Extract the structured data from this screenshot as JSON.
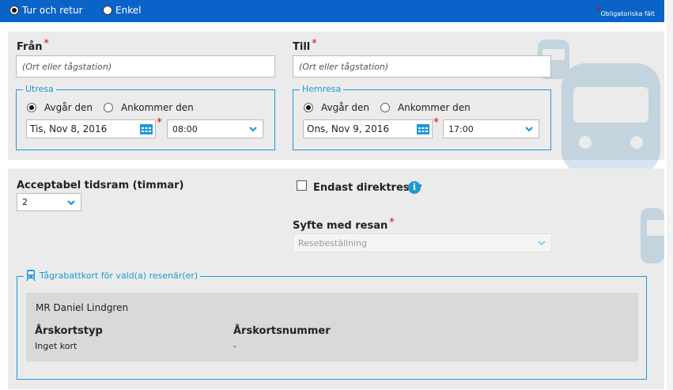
{
  "topbar": {
    "trip_types": [
      {
        "label": "Tur och retur",
        "selected": true
      },
      {
        "label": "Enkel",
        "selected": false
      }
    ],
    "required_note": "Obligatoriska fält",
    "required_marker": "*"
  },
  "from": {
    "label": "Från",
    "placeholder": "(Ort eller tågstation)"
  },
  "to": {
    "label": "Till",
    "placeholder": "(Ort eller tågstation)"
  },
  "outbound": {
    "legend": "Utresa",
    "depart_label": "Avgår den",
    "arrive_label": "Ankommer den",
    "date": "Tis, Nov 8, 2016",
    "time": "08:00"
  },
  "return": {
    "legend": "Hemresa",
    "depart_label": "Avgår den",
    "arrive_label": "Ankommer den",
    "date": "Ons, Nov 9, 2016",
    "time": "17:00"
  },
  "time_window": {
    "label": "Acceptabel tidsram (timmar)",
    "value": "2"
  },
  "direct_only": {
    "label": "Endast direktresor",
    "checked": false,
    "info_icon": "i"
  },
  "purpose": {
    "label": "Syfte med resan",
    "value": "Resebeställning"
  },
  "rail_card": {
    "legend": "Tågrabattkort för vald(a) resenär(er)",
    "passenger": "MR Daniel Lindgren",
    "type_header": "Årskortstyp",
    "type_value": "Inget kort",
    "number_header": "Årskortsnummer",
    "number_value": "-"
  },
  "colors": {
    "topbar": "#0a63c8",
    "accent": "#1b9ad6",
    "required": "#e00000",
    "panel": "#ebebeb"
  },
  "icons": [
    "calendar-icon",
    "chevron-down-icon",
    "info-icon",
    "train-icon"
  ]
}
